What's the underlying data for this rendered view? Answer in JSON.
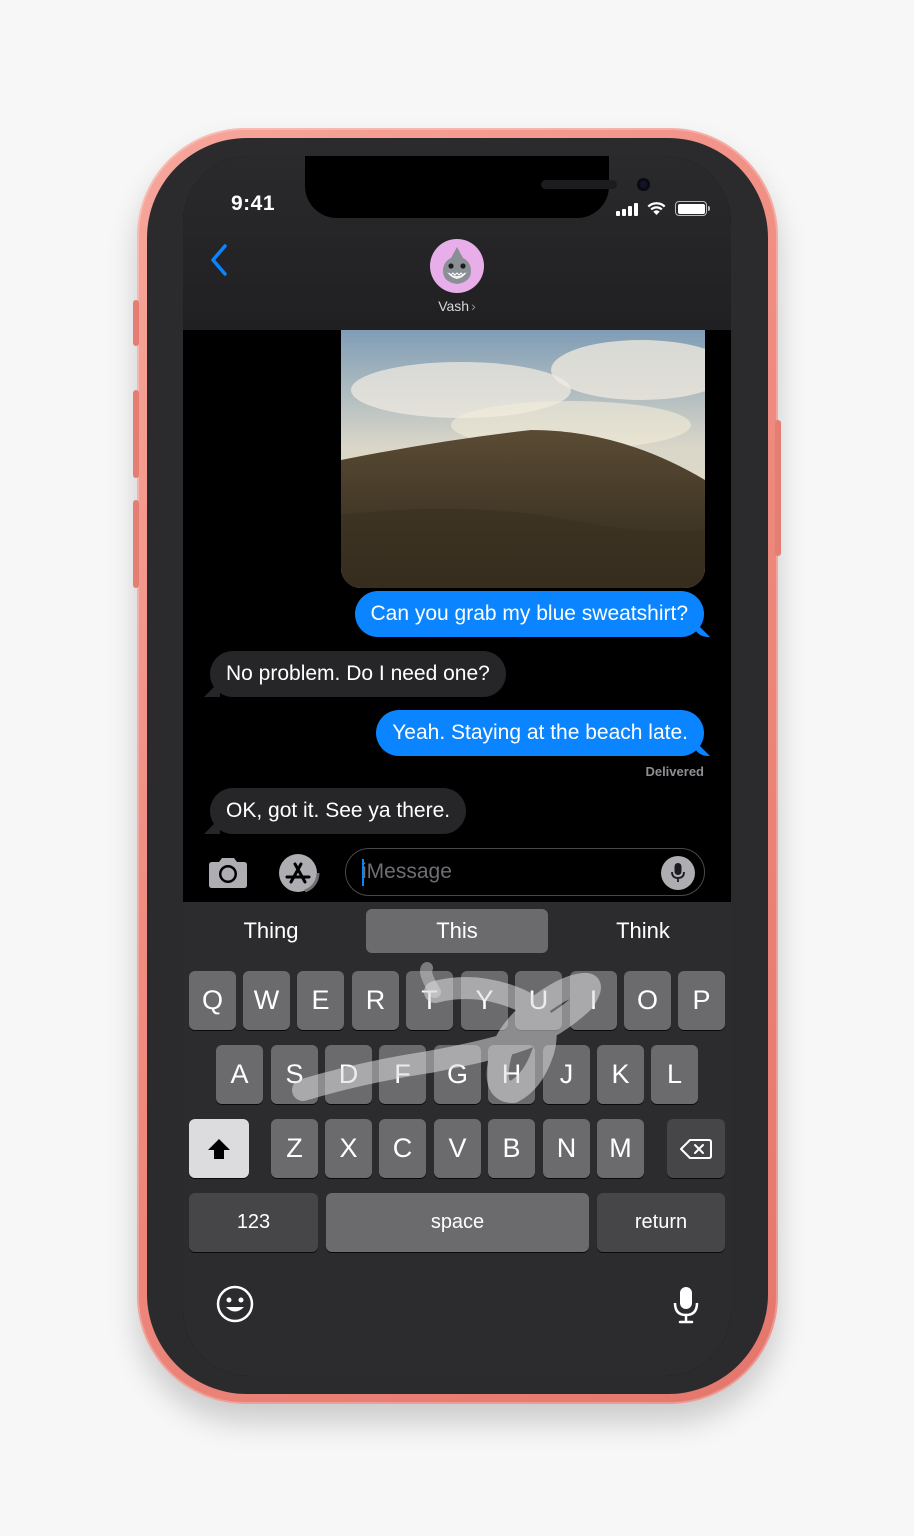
{
  "status_bar": {
    "time": "9:41",
    "icons": [
      "cellular-signal-icon",
      "wifi-icon",
      "battery-icon"
    ]
  },
  "header": {
    "back_icon": "chevron-left-icon",
    "contact_name": "Vash",
    "contact_chevron": "›",
    "avatar": "shark-memoji-avatar"
  },
  "conversation": {
    "attachment": "photo-hill-under-clouds",
    "messages": [
      {
        "direction": "sent",
        "text": "Can you grab my blue sweatshirt?"
      },
      {
        "direction": "received",
        "text": "No problem. Do I need one?"
      },
      {
        "direction": "sent",
        "text": "Yeah. Staying at the beach late."
      },
      {
        "direction": "received",
        "text": "OK, got it. See ya there."
      }
    ],
    "delivered_label": "Delivered"
  },
  "input_bar": {
    "camera_icon": "camera-icon",
    "appstore_icon": "app-store-icon",
    "placeholder": "iMessage",
    "value": "",
    "dictation_icon": "microphone-icon"
  },
  "keyboard": {
    "predictions": [
      {
        "label": "Thing",
        "selected": false
      },
      {
        "label": "This",
        "selected": true
      },
      {
        "label": "Think",
        "selected": false
      }
    ],
    "row1": [
      "Q",
      "W",
      "E",
      "R",
      "T",
      "Y",
      "U",
      "I",
      "O",
      "P"
    ],
    "row2": [
      "A",
      "S",
      "D",
      "F",
      "G",
      "H",
      "J",
      "K",
      "L"
    ],
    "row3": [
      "Z",
      "X",
      "C",
      "V",
      "B",
      "N",
      "M"
    ],
    "shift_icon": "shift-arrow-icon",
    "delete_icon": "backspace-icon",
    "numbers_label": "123",
    "space_label": "space",
    "return_label": "return",
    "emoji_icon": "emoji-smiley-icon",
    "mic_icon": "microphone-icon",
    "swipe_trail": "quickpath-swipe-trail"
  },
  "colors": {
    "phone_body": "#ef8b80",
    "sent_bubble": "#0a84ff",
    "received_bubble": "#262629",
    "keyboard_bg": "#2c2c2e",
    "key": "#6b6b6e"
  }
}
